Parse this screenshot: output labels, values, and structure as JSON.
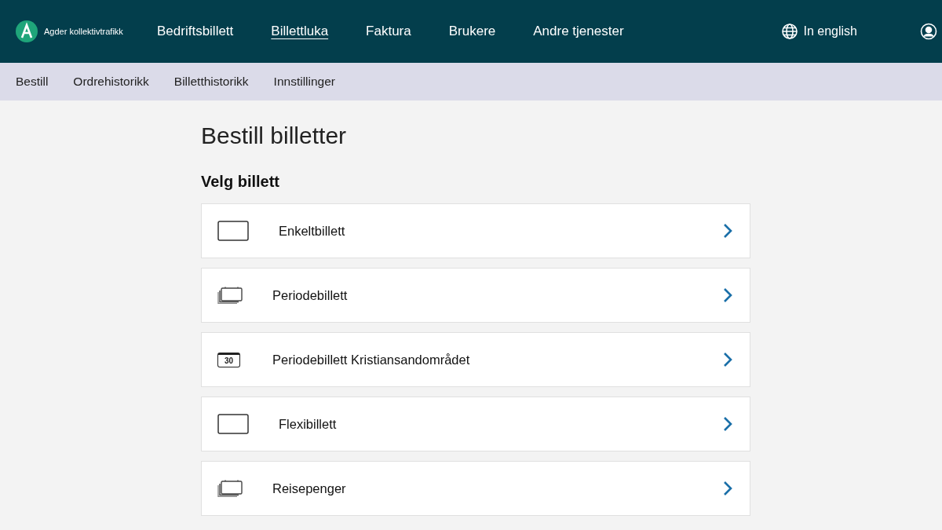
{
  "header": {
    "logo_text": "Agder kollektivtrafikk",
    "nav": [
      {
        "label": "Bedriftsbillett",
        "selected": false
      },
      {
        "label": "Billettluka",
        "selected": true
      },
      {
        "label": "Faktura",
        "selected": false
      },
      {
        "label": "Brukere",
        "selected": false
      },
      {
        "label": "Andre tjenester",
        "selected": false
      }
    ],
    "language": "In english"
  },
  "subnav": [
    "Bestill",
    "Ordrehistorikk",
    "Billetthistorikk",
    "Innstillinger"
  ],
  "title": "Bestill billetter",
  "section_title": "Velg billett",
  "tickets": [
    {
      "kind": "single",
      "label": "Enkeltbillett"
    },
    {
      "kind": "stack",
      "label": "Periodebillett"
    },
    {
      "kind": "calendar",
      "label": "Periodebillett Kristiansandområdet",
      "icon_text": "30"
    },
    {
      "kind": "single",
      "label": "Flexibillett"
    },
    {
      "kind": "stack",
      "label": "Reisepenger"
    }
  ]
}
